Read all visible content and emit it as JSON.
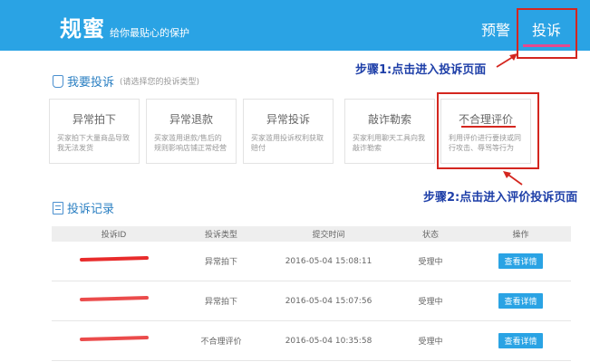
{
  "header": {
    "brand": "规蜜",
    "slogan": "给你最贴心的保护",
    "nav": {
      "warning": "预警",
      "complaint": "投诉"
    }
  },
  "complain_section": {
    "title": "我要投诉",
    "hint": "(请选择您的投诉类型)",
    "cards": [
      {
        "title": "异常拍下",
        "desc": "买家拍下大量商品导致我无法发货"
      },
      {
        "title": "异常退款",
        "desc": "买家滥用退款/售后的规则影响店铺正常经营"
      },
      {
        "title": "异常投诉",
        "desc": "买家滥用投诉权利获取赔付"
      },
      {
        "title": "敲诈勒索",
        "desc": "买家利用聊天工具向我敲诈勒索"
      },
      {
        "title": "不合理评价",
        "desc": "利用评价进行要挟或同行攻击、辱骂等行为"
      }
    ]
  },
  "annotations": {
    "step1": "步骤1:点击进入投诉页面",
    "step2": "步骤2:点击进入评价投诉页面"
  },
  "records_section": {
    "title": "投诉记录",
    "columns": [
      "投诉ID",
      "投诉类型",
      "提交时间",
      "状态",
      "操作"
    ],
    "rows": [
      {
        "type": "异常拍下",
        "time": "2016-05-04 15:08:11",
        "status": "受理中",
        "action": "查看详情"
      },
      {
        "type": "异常拍下",
        "time": "2016-05-04 15:07:56",
        "status": "受理中",
        "action": "查看详情"
      },
      {
        "type": "不合理评价",
        "time": "2016-05-04 10:35:58",
        "status": "受理中",
        "action": "查看详情"
      }
    ]
  },
  "colors": {
    "header_bg": "#2aa3e4",
    "annotation_red": "#d4261f",
    "annotation_blue": "#1e3fa8",
    "button_blue": "#2aa3e4"
  }
}
